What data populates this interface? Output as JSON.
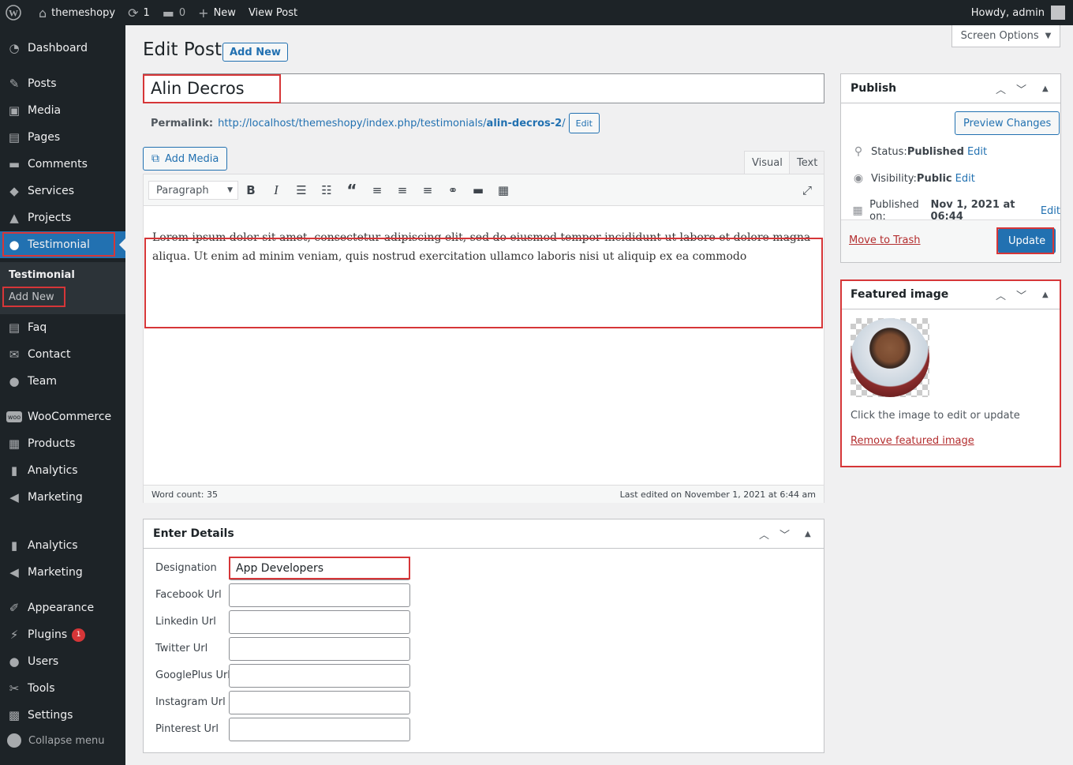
{
  "adminbar": {
    "site_name": "themeshopy",
    "updates_count": "1",
    "comments_count": "0",
    "new_label": "New",
    "view_post": "View Post",
    "howdy": "Howdy, admin"
  },
  "sidebar": {
    "items": [
      {
        "label": "Dashboard",
        "icon": "dashboard-icon"
      },
      {
        "label": "Posts",
        "icon": "pin-icon"
      },
      {
        "label": "Media",
        "icon": "media-icon"
      },
      {
        "label": "Pages",
        "icon": "pages-icon"
      },
      {
        "label": "Comments",
        "icon": "comment-icon"
      },
      {
        "label": "Services",
        "icon": "tag-icon"
      },
      {
        "label": "Projects",
        "icon": "graduation-cap-icon"
      },
      {
        "label": "Testimonial",
        "icon": "user-icon"
      },
      {
        "label": "Faq",
        "icon": "document-icon"
      },
      {
        "label": "Contact",
        "icon": "mail-icon"
      },
      {
        "label": "Team",
        "icon": "user-icon"
      },
      {
        "label": "WooCommerce",
        "icon": "woo-icon"
      },
      {
        "label": "Products",
        "icon": "archive-icon"
      },
      {
        "label": "Analytics",
        "icon": "bar-chart-icon"
      },
      {
        "label": "Marketing",
        "icon": "megaphone-icon"
      },
      {
        "label": "Analytics",
        "icon": "bar-chart-icon"
      },
      {
        "label": "Marketing",
        "icon": "megaphone-icon"
      },
      {
        "label": "Appearance",
        "icon": "brush-icon"
      },
      {
        "label": "Plugins",
        "icon": "plug-icon"
      },
      {
        "label": "Users",
        "icon": "user-icon"
      },
      {
        "label": "Tools",
        "icon": "wrench-icon"
      },
      {
        "label": "Settings",
        "icon": "settings-icon"
      }
    ],
    "submenu": {
      "title": "Testimonial",
      "add_new": "Add New"
    },
    "plugins_badge": "1",
    "collapse": "Collapse menu"
  },
  "header": {
    "screen_options": "Screen Options",
    "page_title": "Edit Post",
    "add_new": "Add New"
  },
  "post": {
    "title": "Alin Decros",
    "permalink_label": "Permalink:",
    "permalink_base": "http://localhost/themeshopy/index.php/testimonials/",
    "permalink_slug": "alin-decros-2",
    "permalink_trail": "/",
    "permalink_edit": "Edit",
    "add_media": "Add Media",
    "tab_visual": "Visual",
    "tab_text": "Text",
    "format": "Paragraph",
    "content": "Lorem ipsum dolor sit amet, consectetur adipiscing elit, sed do eiusmod tempor incididunt ut labore et dolore magna aliqua. Ut enim ad minim veniam, quis nostrud exercitation ullamco laboris nisi ut aliquip ex ea commodo",
    "word_count": "Word count: 35",
    "last_edited": "Last edited on November 1, 2021 at 6:44 am"
  },
  "details": {
    "title": "Enter Details",
    "fields": [
      {
        "label": "Designation",
        "value": "App Developers"
      },
      {
        "label": "Facebook Url",
        "value": ""
      },
      {
        "label": "Linkedin Url",
        "value": ""
      },
      {
        "label": "Twitter Url",
        "value": ""
      },
      {
        "label": "GooglePlus Url",
        "value": ""
      },
      {
        "label": "Instagram Url",
        "value": ""
      },
      {
        "label": "Pinterest Url",
        "value": ""
      }
    ]
  },
  "publish": {
    "title": "Publish",
    "preview": "Preview Changes",
    "status_label": "Status: ",
    "status_value": "Published",
    "visibility_label": "Visibility: ",
    "visibility_value": "Public",
    "published_label": "Published on: ",
    "published_value": "Nov 1, 2021 at 06:44",
    "edit": "Edit",
    "trash": "Move to Trash",
    "update": "Update"
  },
  "featured": {
    "title": "Featured image",
    "hint": "Click the image to edit or update",
    "remove": "Remove featured image"
  },
  "colors": {
    "accent": "#2271b1",
    "highlight": "#d63638",
    "admin_dark": "#1d2327"
  }
}
